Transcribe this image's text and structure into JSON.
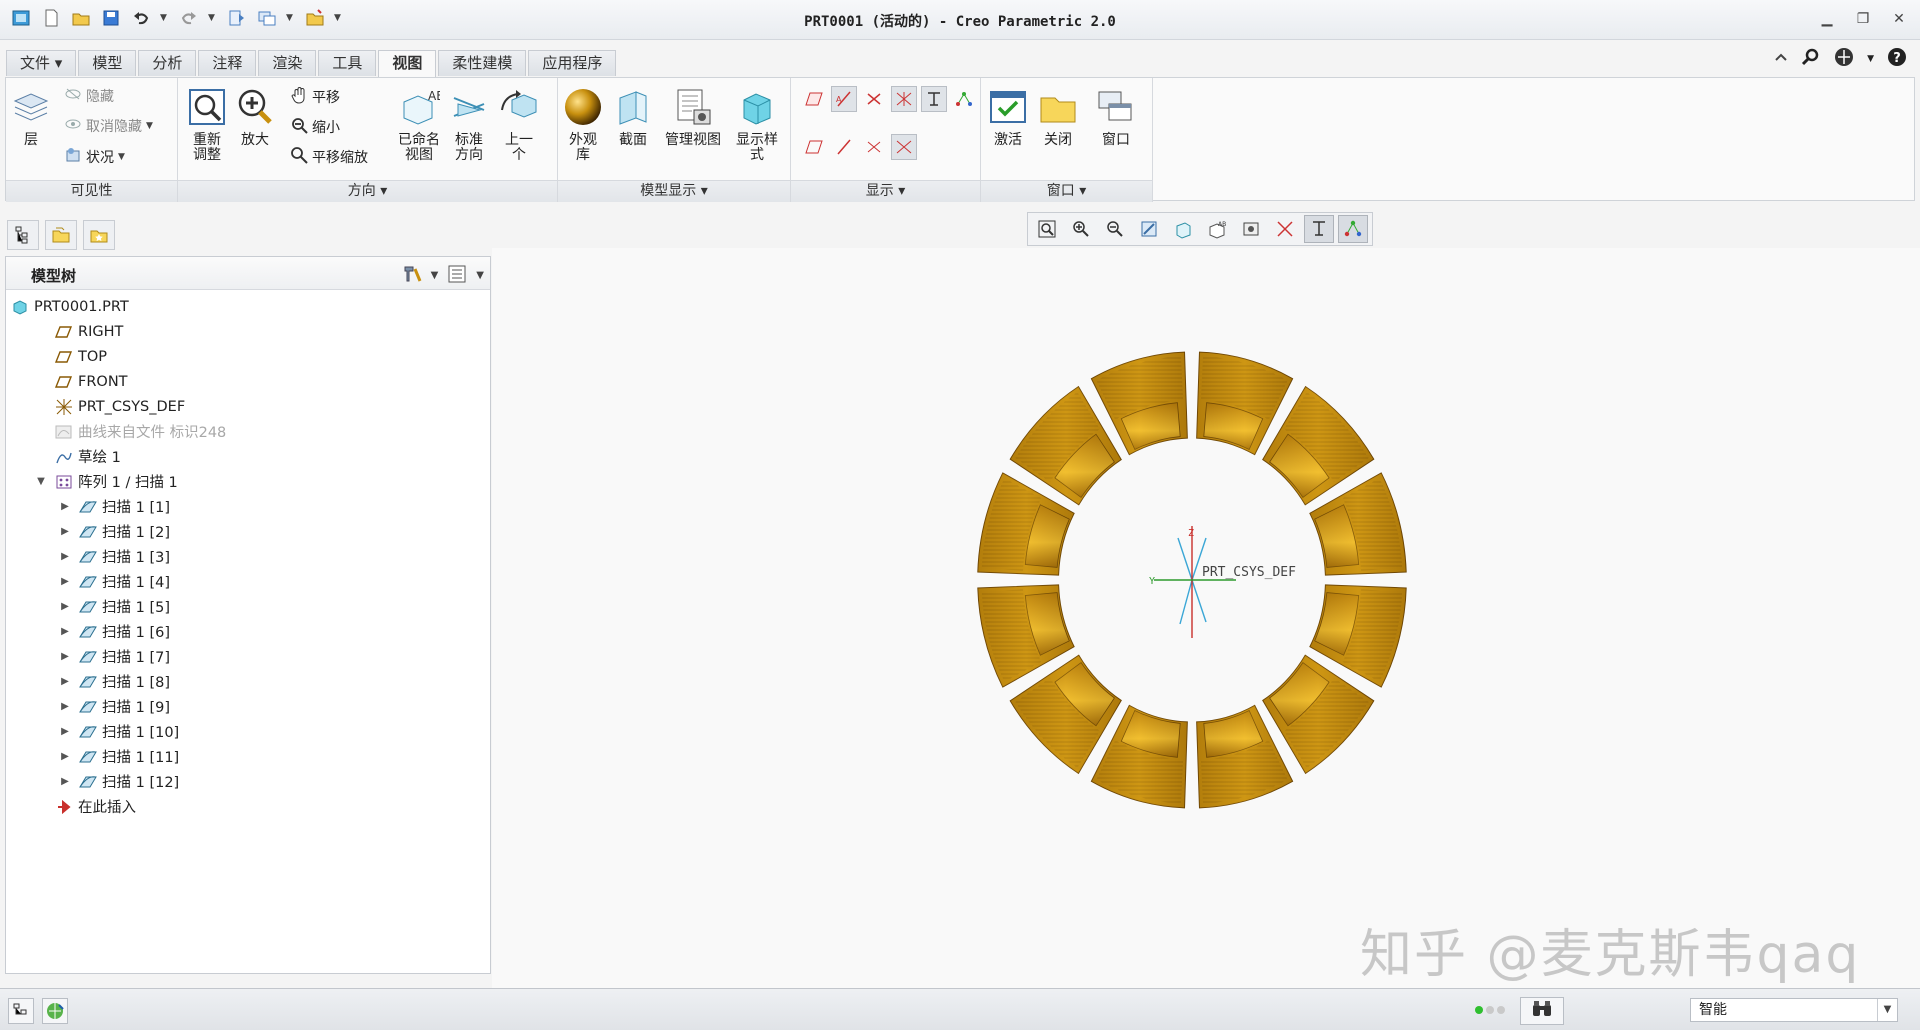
{
  "window": {
    "title": "PRT0001 (活动的) - Creo Parametric 2.0"
  },
  "ribbon_tabs": [
    {
      "label": "文件 ▾"
    },
    {
      "label": "模型"
    },
    {
      "label": "分析"
    },
    {
      "label": "注释"
    },
    {
      "label": "渲染"
    },
    {
      "label": "工具"
    },
    {
      "label": "视图"
    },
    {
      "label": "柔性建模"
    },
    {
      "label": "应用程序"
    }
  ],
  "groups": {
    "visibility": {
      "label": "可见性",
      "layer": "层",
      "hide": "隐藏",
      "unhide": "取消隐藏",
      "status": "状况"
    },
    "orientation": {
      "label": "方向 ▾",
      "refit": "重新\n调整",
      "zoom_in": "放大",
      "pan": "平移",
      "zoom_out": "缩小",
      "pan_zoom": "平移缩放",
      "named_views": "已命名\n视图",
      "standard_orientation": "标准\n方向",
      "previous": "上一\n个"
    },
    "model_display": {
      "label": "模型显示 ▾",
      "appearance_gallery": "外观\n库",
      "section": "截面",
      "manage_views": "管理视图",
      "display_style": "显示样\n式"
    },
    "show": {
      "label": "显示 ▾"
    },
    "window": {
      "label": "窗口 ▾",
      "activate": "激活",
      "close": "关闭",
      "windows": "窗口"
    }
  },
  "model_tree": {
    "header": "模型树",
    "items": [
      {
        "label": "PRT0001.PRT",
        "icon": "part-icon",
        "indent": 0,
        "arrow": "",
        "dim": false
      },
      {
        "label": "RIGHT",
        "icon": "datum-plane-icon",
        "indent": 1,
        "arrow": "",
        "dim": false
      },
      {
        "label": "TOP",
        "icon": "datum-plane-icon",
        "indent": 1,
        "arrow": "",
        "dim": false
      },
      {
        "label": "FRONT",
        "icon": "datum-plane-icon",
        "indent": 1,
        "arrow": "",
        "dim": false
      },
      {
        "label": "PRT_CSYS_DEF",
        "icon": "csys-icon",
        "indent": 1,
        "arrow": "",
        "dim": false
      },
      {
        "label": "曲线来自文件 标识248",
        "icon": "curve-icon",
        "indent": 1,
        "arrow": "",
        "dim": true
      },
      {
        "label": "草绘 1",
        "icon": "sketch-icon",
        "indent": 1,
        "arrow": "",
        "dim": false
      },
      {
        "label": "阵列 1 / 扫描 1",
        "icon": "pattern-icon",
        "indent": 1,
        "arrow": "▼",
        "dim": false
      },
      {
        "label": "扫描 1 [1]",
        "icon": "sweep-icon",
        "indent": 2,
        "arrow": "▶",
        "dim": false
      },
      {
        "label": "扫描 1 [2]",
        "icon": "sweep-icon",
        "indent": 2,
        "arrow": "▶",
        "dim": false
      },
      {
        "label": "扫描 1 [3]",
        "icon": "sweep-icon",
        "indent": 2,
        "arrow": "▶",
        "dim": false
      },
      {
        "label": "扫描 1 [4]",
        "icon": "sweep-icon",
        "indent": 2,
        "arrow": "▶",
        "dim": false
      },
      {
        "label": "扫描 1 [5]",
        "icon": "sweep-icon",
        "indent": 2,
        "arrow": "▶",
        "dim": false
      },
      {
        "label": "扫描 1 [6]",
        "icon": "sweep-icon",
        "indent": 2,
        "arrow": "▶",
        "dim": false
      },
      {
        "label": "扫描 1 [7]",
        "icon": "sweep-icon",
        "indent": 2,
        "arrow": "▶",
        "dim": false
      },
      {
        "label": "扫描 1 [8]",
        "icon": "sweep-icon",
        "indent": 2,
        "arrow": "▶",
        "dim": false
      },
      {
        "label": "扫描 1 [9]",
        "icon": "sweep-icon",
        "indent": 2,
        "arrow": "▶",
        "dim": false
      },
      {
        "label": "扫描 1 [10]",
        "icon": "sweep-icon",
        "indent": 2,
        "arrow": "▶",
        "dim": false
      },
      {
        "label": "扫描 1 [11]",
        "icon": "sweep-icon",
        "indent": 2,
        "arrow": "▶",
        "dim": false
      },
      {
        "label": "扫描 1 [12]",
        "icon": "sweep-icon",
        "indent": 2,
        "arrow": "▶",
        "dim": false
      },
      {
        "label": "在此插入",
        "icon": "insert-here-icon",
        "indent": 1,
        "arrow": "",
        "dim": false
      }
    ]
  },
  "viewport": {
    "csys_label": "PRT_CSYS_DEF",
    "pattern_count": 12,
    "model_color": "#c8900f"
  },
  "status_bar": {
    "filter": "智能"
  },
  "watermark": "知乎 @麦克斯韦qaq"
}
